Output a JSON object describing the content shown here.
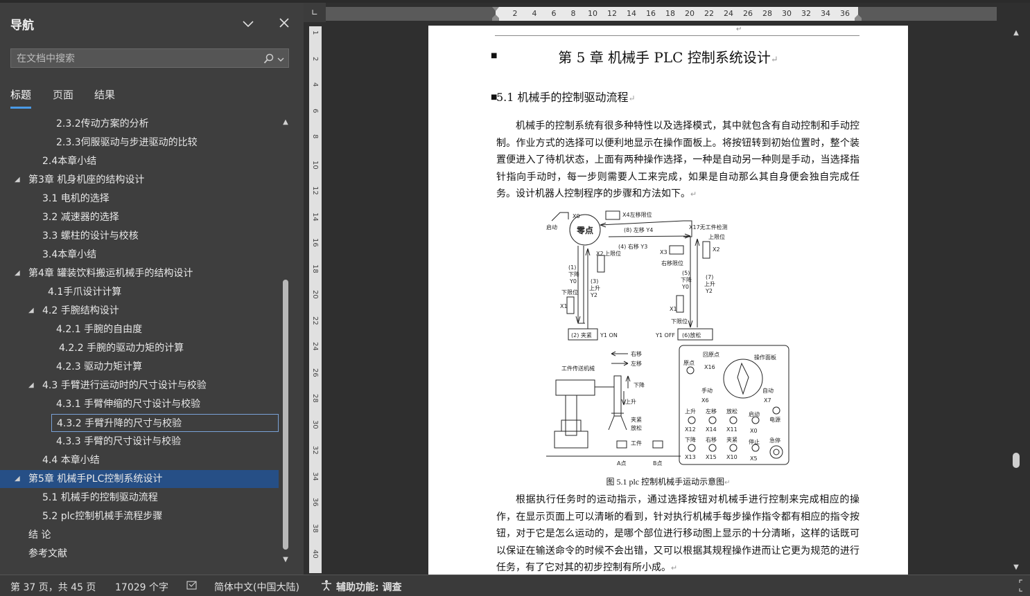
{
  "nav": {
    "title": "导航",
    "search_placeholder": "在文档中搜索",
    "tabs": [
      {
        "label": "标题",
        "active": true
      },
      {
        "label": "页面",
        "active": false
      },
      {
        "label": "结果",
        "active": false
      }
    ],
    "tree": [
      {
        "label": "2.3.2传动方案的分析",
        "level": 3,
        "expander": ""
      },
      {
        "label": "2.3.3伺服驱动与步进驱动的比较",
        "level": 3,
        "expander": ""
      },
      {
        "label": "2.4本章小结",
        "level": 2,
        "expander": ""
      },
      {
        "label": "第3章  机身机座的结构设计",
        "level": 1,
        "expander": "◢"
      },
      {
        "label": "3.1  电机的选择",
        "level": 2,
        "expander": ""
      },
      {
        "label": "3.2  减速器的选择",
        "level": 2,
        "expander": ""
      },
      {
        "label": "3.3  螺柱的设计与校核",
        "level": 2,
        "expander": ""
      },
      {
        "label": "3.4本章小结",
        "level": 2,
        "expander": ""
      },
      {
        "label": "第4章  罐装饮料搬运机械手的结构设计",
        "level": 1,
        "expander": "◢"
      },
      {
        "label": "4.1手爪设计计算",
        "level": 2.4,
        "expander": ""
      },
      {
        "label": "4.2  手腕结构设计",
        "level": 2,
        "expander": "◢"
      },
      {
        "label": "4.2.1  手腕的自由度",
        "level": 3,
        "expander": ""
      },
      {
        "label": "4.2.2  手腕的驱动力矩的计算",
        "level": 3.2,
        "expander": ""
      },
      {
        "label": "4.2.3  驱动力矩计算",
        "level": 3,
        "expander": ""
      },
      {
        "label": "4.3  手臂进行运动时的尺寸设计与校验",
        "level": 2,
        "expander": "◢"
      },
      {
        "label": "4.3.1 手臂伸缩的尺寸设计与校验",
        "level": 3,
        "expander": ""
      },
      {
        "label": "4.3.2 手臂升降的尺寸与校验",
        "level": 3,
        "expander": "",
        "state": "current"
      },
      {
        "label": "4.3.3 手臂的尺寸设计与校验",
        "level": 3,
        "expander": ""
      },
      {
        "label": "4.4 本章小结",
        "level": 2,
        "expander": ""
      },
      {
        "label": "第5章  机械手PLC控制系统设计",
        "level": 1,
        "expander": "◢",
        "state": "selected"
      },
      {
        "label": "5.1 机械手的控制驱动流程",
        "level": 2,
        "expander": ""
      },
      {
        "label": "5.2 plc控制机械手流程步骤",
        "level": 2,
        "expander": ""
      },
      {
        "label": "结    论",
        "level": 1,
        "expander": ""
      },
      {
        "label": "参考文献",
        "level": 1,
        "expander": ""
      }
    ]
  },
  "ruler": {
    "h_ticks": [
      "2",
      "4",
      "6",
      "8",
      "10",
      "12",
      "14",
      "16",
      "18",
      "20",
      "22",
      "24",
      "26",
      "28",
      "30",
      "32",
      "34",
      "36"
    ],
    "v_ticks": [
      "1",
      "2",
      "4",
      "6",
      "8",
      "10",
      "12",
      "14",
      "16",
      "18",
      "20",
      "22",
      "24",
      "26",
      "28",
      "30",
      "32",
      "34",
      "36",
      "38",
      "40"
    ]
  },
  "document": {
    "chapter_title": "第 5 章   机械手 PLC 控制系统设计",
    "section_title": "5.1  机械手的控制驱动流程",
    "para1": "机械手的控制系统有很多种特性以及选择模式，其中就包含有自动控制和手动控制。作业方式的选择可以便利地显示在操作面板上。将按钮转到初始位置时，整个装置便进入了待机状态，上面有两种操作选择，一种是自动另一种则是手动，当选择指针指向手动时，每一步则需要人工来完成，如果是自动那么其自身便会独自完成任务。设计机器人控制程序的步骤和方法如下。",
    "para2": "根据执行任务时的运动指示，通过选择按钮对机械手进行控制来完成相应的操作，在显示页面上可以清晰的看到，针对执行机械手每步操作指令都有相应的指令按钮，对于它是怎么运动的，是哪个部位进行移动图上显示的十分清晰，这样的话既可以保证在输送命令的时候不会出错，又可以根据其规程操作进而让它更为规范的进行任务，有了它对其的初步控制有所小成。",
    "caption": "图 5.1 plc 控制机械手运动示意图",
    "paragraph_mark": "↵",
    "figure": {
      "zero": "零点",
      "start": "启动",
      "x0": "X0",
      "x4": "X4左移限位",
      "step8": "(8)  左移  Y4",
      "x17": "X17无工件检测",
      "up_limit_r": "上限位",
      "x2r": "X2",
      "step4": "(4)  右移  Y3",
      "x3": "X3",
      "right_limit": "右移限位",
      "x2l": "X2",
      "up_limit_l": "上限位",
      "step1": "(1)",
      "down1": "下降",
      "y0l": "Y0",
      "step3": "(3)",
      "up3": "上升",
      "y2l": "Y2",
      "down_limit_l": "下限位",
      "x1l": "X1",
      "step5": "(5)",
      "down5": "下降",
      "y0r": "Y0",
      "step7": "(7)",
      "up7": "上升",
      "y2r": "Y2",
      "x1r": "X1",
      "down_limit_r": "下限位",
      "clamp": "(2) 夹紧",
      "y1on": "Y1 ON",
      "y1off": "Y1 OFF",
      "release": "(6)放松",
      "arrow_right": "右移",
      "arrow_left": "左移",
      "conveyor": "工件传送机械",
      "m_down": "下降",
      "m_up": "上升",
      "m_clamp": "夹紧",
      "m_release": "放松",
      "workpiece": "工件",
      "point_a": "A点",
      "point_b": "B点",
      "panel": {
        "origin": "原点",
        "back_origin": "回原点",
        "x16": "X16",
        "op_panel": "操作面板",
        "manual": "手动",
        "x6": "X6",
        "auto": "自动",
        "x7": "X7",
        "row1": [
          "上升",
          "左移",
          "放松",
          "启动"
        ],
        "row1codes": [
          "X12",
          "X14",
          "X11",
          "X0"
        ],
        "power": "电源",
        "row2": [
          "下降",
          "右移",
          "夹紧",
          "停止"
        ],
        "row2codes": [
          "X13",
          "X15",
          "X10",
          "X5"
        ],
        "estop": "急停"
      }
    }
  },
  "status": {
    "page": "第 37 页，共 45 页",
    "words": "17029 个字",
    "language": "简体中文(中国大陆)",
    "accessibility": "辅助功能: 调查"
  }
}
